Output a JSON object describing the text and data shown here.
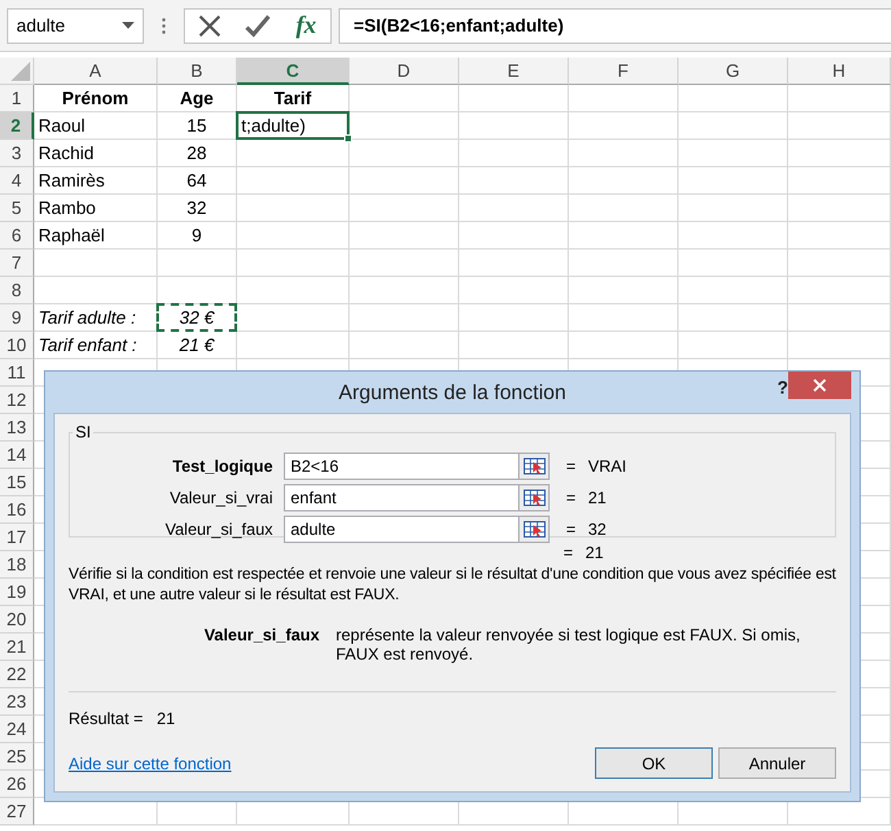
{
  "formula_bar": {
    "name_box": "adulte",
    "insert_function": "fx",
    "formula": "=SI(B2<16;enfant;adulte)"
  },
  "sheet": {
    "columns": [
      {
        "label": "A",
        "selected": false
      },
      {
        "label": "B",
        "selected": false
      },
      {
        "label": "C",
        "selected": true
      },
      {
        "label": "D",
        "selected": false
      },
      {
        "label": "E",
        "selected": false
      },
      {
        "label": "F",
        "selected": false
      },
      {
        "label": "G",
        "selected": false
      },
      {
        "label": "H",
        "selected": false
      }
    ],
    "rows": [
      {
        "number": "1",
        "selected": false,
        "kind": "header",
        "cells": [
          {
            "text": "Prénom",
            "selected": false,
            "copy_marked": false
          },
          {
            "text": "Age",
            "selected": false,
            "copy_marked": false
          },
          {
            "text": "Tarif",
            "selected": false,
            "copy_marked": false
          }
        ]
      },
      {
        "number": "2",
        "selected": true,
        "kind": "data",
        "cells": [
          {
            "text": "Raoul",
            "selected": false,
            "copy_marked": false
          },
          {
            "text": "15",
            "selected": false,
            "copy_marked": false
          },
          {
            "text": "t;adulte)",
            "selected": true,
            "copy_marked": false
          }
        ]
      },
      {
        "number": "3",
        "selected": false,
        "kind": "data",
        "cells": [
          {
            "text": "Rachid",
            "selected": false,
            "copy_marked": false
          },
          {
            "text": "28",
            "selected": false,
            "copy_marked": false
          }
        ]
      },
      {
        "number": "4",
        "selected": false,
        "kind": "data",
        "cells": [
          {
            "text": "Ramirès",
            "selected": false,
            "copy_marked": false
          },
          {
            "text": "64",
            "selected": false,
            "copy_marked": false
          }
        ]
      },
      {
        "number": "5",
        "selected": false,
        "kind": "data",
        "cells": [
          {
            "text": "Rambo",
            "selected": false,
            "copy_marked": false
          },
          {
            "text": "32",
            "selected": false,
            "copy_marked": false
          }
        ]
      },
      {
        "number": "6",
        "selected": false,
        "kind": "data",
        "cells": [
          {
            "text": "Raphaël",
            "selected": false,
            "copy_marked": false
          },
          {
            "text": "9",
            "selected": false,
            "copy_marked": false
          }
        ]
      },
      {
        "number": "7",
        "selected": false,
        "cells": []
      },
      {
        "number": "8",
        "selected": false,
        "cells": []
      },
      {
        "number": "9",
        "selected": false,
        "kind": "italic",
        "cells": [
          {
            "text": "Tarif adulte :",
            "selected": false,
            "copy_marked": false
          },
          {
            "text": "32 €",
            "selected": false,
            "copy_marked": true
          }
        ]
      },
      {
        "number": "10",
        "selected": false,
        "kind": "italic",
        "cells": [
          {
            "text": "Tarif enfant :",
            "selected": false,
            "copy_marked": false
          },
          {
            "text": "21 €",
            "selected": false,
            "copy_marked": false
          }
        ]
      },
      {
        "number": "11",
        "selected": false,
        "cells": []
      },
      {
        "number": "12",
        "selected": false,
        "cells": []
      },
      {
        "number": "13",
        "selected": false,
        "cells": []
      },
      {
        "number": "14",
        "selected": false,
        "cells": []
      },
      {
        "number": "15",
        "selected": false,
        "cells": []
      },
      {
        "number": "16",
        "selected": false,
        "cells": []
      },
      {
        "number": "17",
        "selected": false,
        "cells": []
      },
      {
        "number": "18",
        "selected": false,
        "cells": []
      },
      {
        "number": "19",
        "selected": false,
        "cells": []
      },
      {
        "number": "20",
        "selected": false,
        "cells": []
      },
      {
        "number": "21",
        "selected": false,
        "cells": []
      },
      {
        "number": "22",
        "selected": false,
        "cells": []
      },
      {
        "number": "23",
        "selected": false,
        "cells": []
      },
      {
        "number": "24",
        "selected": false,
        "cells": []
      },
      {
        "number": "25",
        "selected": false,
        "cells": []
      },
      {
        "number": "26",
        "selected": false,
        "cells": []
      },
      {
        "number": "27",
        "selected": false,
        "cells": []
      }
    ]
  },
  "dialog": {
    "title": "Arguments de la fonction",
    "help": "?",
    "function_name": "SI",
    "arguments": [
      {
        "label": "Test_logique",
        "required": true,
        "value": "B2<16",
        "equals": "=",
        "result": "VRAI"
      },
      {
        "label": "Valeur_si_vrai",
        "required": false,
        "value": "enfant",
        "equals": "=",
        "result": "21"
      },
      {
        "label": "Valeur_si_faux",
        "required": false,
        "value": "adulte",
        "equals": "=",
        "result": "32"
      }
    ],
    "function_result": {
      "equals": "=",
      "value": "21"
    },
    "description": "Vérifie si la condition est respectée et renvoie une valeur si le résultat d'une condition que vous avez spécifiée est VRAI, et une autre valeur si le résultat est FAUX.",
    "argument_help": {
      "name": "Valeur_si_faux",
      "text": "représente la valeur renvoyée si test logique est FAUX. Si omis, FAUX est renvoyé."
    },
    "result_label": "Résultat =",
    "result_value": "21",
    "help_link": "Aide sur cette fonction",
    "buttons": [
      "OK",
      "Annuler"
    ]
  }
}
